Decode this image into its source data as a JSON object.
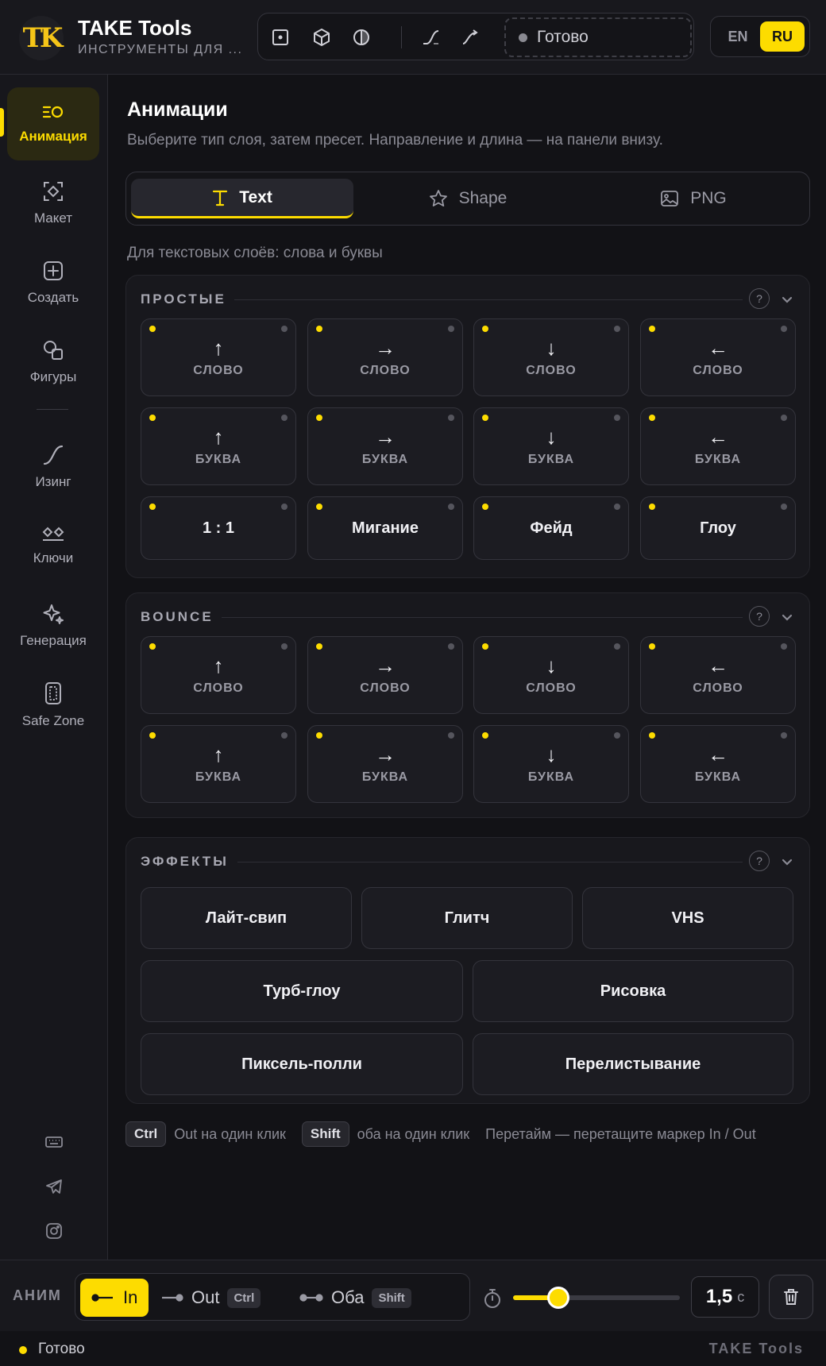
{
  "header": {
    "logo_text": "TK",
    "app_title": "TAKE Tools",
    "app_subtitle": "ИНСТРУМЕНТЫ ДЛЯ ...",
    "status_text": "Готово",
    "lang_en": "EN",
    "lang_ru": "RU",
    "active_lang": "RU"
  },
  "sidebar": {
    "items": [
      {
        "label": "Анимация",
        "icon": "animation-icon",
        "active": true
      },
      {
        "label": "Макет",
        "icon": "layout-icon"
      },
      {
        "label": "Создать",
        "icon": "plus-square-icon"
      },
      {
        "label": "Фигуры",
        "icon": "shapes-icon"
      },
      {
        "label": "Изинг",
        "icon": "easing-curve-icon"
      },
      {
        "label": "Ключи",
        "icon": "keyframes-icon"
      },
      {
        "label": "Генерация",
        "icon": "sparkle-icon"
      },
      {
        "label": "Safe Zone",
        "icon": "safe-zone-icon"
      }
    ],
    "footer_icons": [
      "keyboard-icon",
      "telegram-icon",
      "instagram-icon"
    ]
  },
  "main": {
    "title": "Анимации",
    "subtitle": "Выберите тип слоя, затем пресет. Направление и длина — на панели внизу.",
    "tabs": [
      {
        "label": "Text",
        "icon": "text-icon",
        "active": true
      },
      {
        "label": "Shape",
        "icon": "star-icon"
      },
      {
        "label": "PNG",
        "icon": "image-icon"
      }
    ],
    "hint": "Для текстовых слоёв: слова и буквы",
    "sections": [
      {
        "title": "ПРОСТЫЕ",
        "cards": [
          {
            "arrow": "↑",
            "label": "СЛОВО"
          },
          {
            "arrow": "→",
            "label": "СЛОВО"
          },
          {
            "arrow": "↓",
            "label": "СЛОВО"
          },
          {
            "arrow": "←",
            "label": "СЛОВО"
          },
          {
            "arrow": "↑",
            "label": "БУКВА"
          },
          {
            "arrow": "→",
            "label": "БУКВА"
          },
          {
            "arrow": "↓",
            "label": "БУКВА"
          },
          {
            "arrow": "←",
            "label": "БУКВА"
          },
          {
            "text": "1 : 1"
          },
          {
            "text": "Мигание"
          },
          {
            "text": "Фейд"
          },
          {
            "text": "Глоу"
          }
        ]
      },
      {
        "title": "BOUNCE",
        "cards": [
          {
            "arrow": "↑",
            "label": "СЛОВО"
          },
          {
            "arrow": "→",
            "label": "СЛОВО"
          },
          {
            "arrow": "↓",
            "label": "СЛОВО"
          },
          {
            "arrow": "←",
            "label": "СЛОВО"
          },
          {
            "arrow": "↑",
            "label": "БУКВА"
          },
          {
            "arrow": "→",
            "label": "БУКВА"
          },
          {
            "arrow": "↓",
            "label": "БУКВА"
          },
          {
            "arrow": "←",
            "label": "БУКВА"
          }
        ]
      },
      {
        "title": "ЭФФЕКТЫ",
        "effects": [
          "Лайт-свип",
          "Глитч",
          "VHS",
          "Турб-глоу",
          "Рисовка",
          "Пиксель-полли",
          "Перелистывание"
        ]
      }
    ],
    "help_glyph": "?",
    "shortcuts": {
      "ctrl_key": "Ctrl",
      "ctrl_desc": "Out на один клик",
      "shift_key": "Shift",
      "shift_desc": "оба на один клик",
      "retime_desc": "Перетайм — перетащите маркер In / Out"
    }
  },
  "bottombar": {
    "label": "АНИМ",
    "modes": [
      {
        "label": "In",
        "active": true
      },
      {
        "label": "Out",
        "kbd": "Ctrl"
      },
      {
        "label": "Оба",
        "kbd": "Shift"
      }
    ],
    "duration_fraction": 0.27,
    "duration_value": "1,5",
    "duration_unit": "с"
  },
  "statusbar": {
    "text": "Готово",
    "brand": "TAKE Tools"
  },
  "colors": {
    "accent": "#fddc00",
    "background": "#121216",
    "panel": "#18181d"
  }
}
